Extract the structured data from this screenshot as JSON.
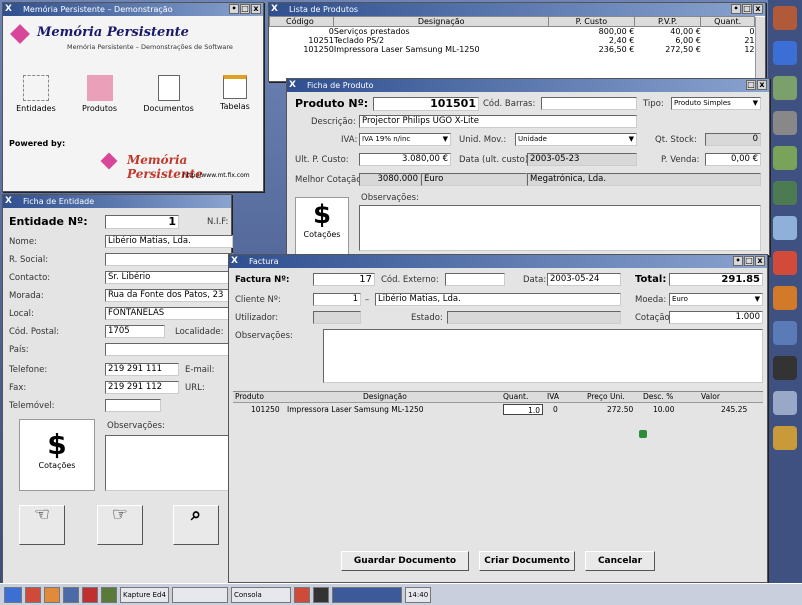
{
  "colors": {
    "titlebar": "#2f4f8f",
    "brand": "#1a1a6a",
    "accent_red": "#c0392b"
  },
  "win_about": {
    "title": "Memória Persistente – Demonstração",
    "brand": "Memória Persistente",
    "subtitle": "Memória Persistente – Demonstrações de Software",
    "icons": [
      "Entidades",
      "Produtos",
      "Documentos",
      "Tabelas"
    ],
    "powered_by": "Powered by:",
    "url": "http://www.mt.fix.com"
  },
  "win_list": {
    "title": "Lista de Produtos",
    "columns": [
      "Código",
      "Designação",
      "P. Custo",
      "P.V.P.",
      "Quant."
    ],
    "rows": [
      [
        "0",
        "Serviços prestados",
        "800,00 €",
        "40,00 €",
        "0"
      ],
      [
        "10251",
        "Teclado PS/2",
        "2,40 €",
        "6,00 €",
        "21"
      ],
      [
        "101250",
        "Impressora Laser Samsung ML-1250",
        "236,50 €",
        "272,50 €",
        "12"
      ]
    ]
  },
  "win_prod": {
    "title": "Ficha de Produto",
    "produto_label": "Produto Nº:",
    "produto": "101501",
    "barras_label": "Cód. Barras:",
    "tipo_label": "Tipo:",
    "tipo": "Produto Simples",
    "descr_label": "Descrição:",
    "descr": "Projector Philips UGO X-Lite",
    "iva_label": "IVA:",
    "iva": "IVA 19% n/inc",
    "unid_label": "Unid. Mov.:",
    "unid": "Unidade",
    "stock_label": "Qt. Stock:",
    "stock": "0",
    "custo_label": "Ult. P. Custo:",
    "custo": "3.080,00 €",
    "data_label": "Data (ult. custo):",
    "data": "2003-05-23",
    "venda_label": "P. Venda:",
    "venda": "0,00 €",
    "cot_label": "Melhor Cotação:",
    "cot": "3080.000",
    "cot_moeda": "Euro",
    "cot_forn": "Megatrónica, Lda.",
    "obs_label": "Observações:",
    "cot_icon_label": "Cotações"
  },
  "win_ent": {
    "title": "Ficha de Entidade",
    "ent_label": "Entidade Nº:",
    "ent": "1",
    "nif_label": "N.I.F:",
    "nome_label": "Nome:",
    "nome": "Libério Matias, Lda.",
    "social_label": "R. Social:",
    "contacto_label": "Contacto:",
    "contacto": "Sr. Libério",
    "morada_label": "Morada:",
    "morada": "Rua da Fonte dos Patos, 23",
    "local_label": "Local:",
    "local": "FONTANELAS",
    "postal_label": "Cód. Postal:",
    "postal": "1705",
    "localidade_label": "Localidade:",
    "pais_label": "País:",
    "tel_label": "Telefone:",
    "tel": "219 291 111",
    "email_label": "E-mail:",
    "fax_label": "Fax:",
    "fax": "219 291 112",
    "url_label": "URL:",
    "movel_label": "Telemóvel:",
    "obs_label": "Observações:",
    "cot_icon_label": "Cotações"
  },
  "win_fact": {
    "title": "Factura",
    "fact_label": "Factura Nº:",
    "fact": "17",
    "ext_label": "Cód. Externo:",
    "data_label": "Data:",
    "data": "2003-05-24",
    "total_label": "Total:",
    "total": "291.85",
    "cliente_label": "Cliente Nº:",
    "cliente": "1",
    "cliente_nome": "Libério Matias, Lda.",
    "moeda_label": "Moeda:",
    "moeda": "Euro",
    "util_label": "Utilizador:",
    "estado_label": "Estado:",
    "cotacao_label": "Cotação:",
    "cotacao": "1.000",
    "obs_label": "Observações:",
    "columns": [
      "Produto",
      "Designação",
      "Quant.",
      "IVA",
      "Preço Uni.",
      "Desc. %",
      "Valor"
    ],
    "line": [
      "101250",
      "Impressora Laser Samsung ML-1250",
      "1.0",
      "0",
      "272.50",
      "10.00",
      "245.25"
    ],
    "btn_guardar": "Guardar Documento",
    "btn_criar": "Criar Documento",
    "btn_cancelar": "Cancelar"
  },
  "taskbar": {
    "items": [
      "Kapture Ed4",
      "",
      "Consola"
    ],
    "clock": "14:40"
  }
}
